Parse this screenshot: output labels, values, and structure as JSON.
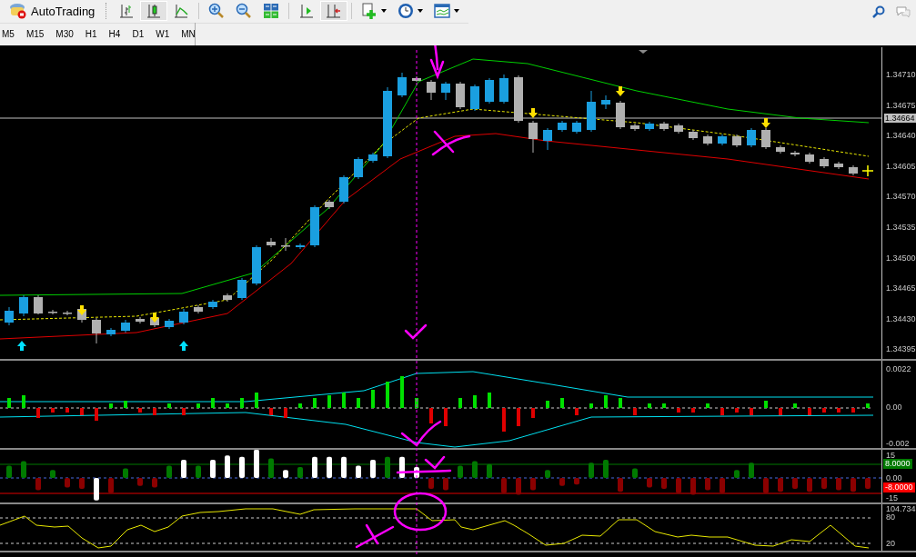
{
  "toolbar": {
    "autotrading": {
      "label": "AutoTrading"
    },
    "tools": [
      {
        "kind": "bar-chart",
        "selected": false
      },
      {
        "kind": "candlesticks",
        "selected": true
      },
      {
        "kind": "line-chart",
        "selected": false
      },
      {
        "kind": "zoom-in",
        "selected": false
      },
      {
        "kind": "zoom-out",
        "selected": false
      },
      {
        "kind": "tile-windows",
        "selected": false
      },
      {
        "kind": "chart-shift",
        "selected": false
      },
      {
        "kind": "auto-scroll",
        "selected": true
      },
      {
        "kind": "new-chart",
        "selected": false
      },
      {
        "kind": "periods",
        "selected": false
      },
      {
        "kind": "templates",
        "selected": false
      }
    ]
  },
  "timeframes": [
    "M5",
    "M15",
    "M30",
    "H1",
    "H4",
    "D1",
    "W1",
    "MN"
  ],
  "price_axis": {
    "ticks": [
      "1.34710",
      "1.34675",
      "1.34640",
      "1.34605",
      "1.34570",
      "1.34535",
      "1.34500",
      "1.34465",
      "1.34430",
      "1.34395"
    ],
    "current_price": "1.34664"
  },
  "indicator_panels": [
    {
      "ticks": [
        "0.0022",
        "0.00",
        "-0.002"
      ]
    },
    {
      "ticks": [
        "15",
        "0.00",
        "-15"
      ],
      "level_labels": [
        {
          "text": "8.0000",
          "color": "#007a00"
        },
        {
          "text": "-8.0000",
          "color": "#ff0000"
        }
      ]
    },
    {
      "ticks": [
        "104.734",
        "80",
        "20"
      ]
    }
  ]
}
